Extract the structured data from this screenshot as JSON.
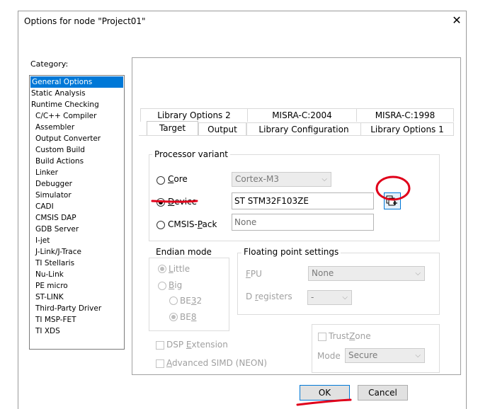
{
  "window": {
    "title": "Options for node \"Project01\""
  },
  "category": {
    "label": "Category:",
    "items": [
      {
        "label": "General Options",
        "indent": false,
        "selected": true
      },
      {
        "label": "Static Analysis",
        "indent": false
      },
      {
        "label": "Runtime Checking",
        "indent": false
      },
      {
        "label": "C/C++ Compiler",
        "indent": true
      },
      {
        "label": "Assembler",
        "indent": true
      },
      {
        "label": "Output Converter",
        "indent": true
      },
      {
        "label": "Custom Build",
        "indent": true
      },
      {
        "label": "Build Actions",
        "indent": true
      },
      {
        "label": "Linker",
        "indent": true
      },
      {
        "label": "Debugger",
        "indent": true
      },
      {
        "label": "Simulator",
        "indent": true
      },
      {
        "label": "CADI",
        "indent": true
      },
      {
        "label": "CMSIS DAP",
        "indent": true
      },
      {
        "label": "GDB Server",
        "indent": true
      },
      {
        "label": "I-jet",
        "indent": true
      },
      {
        "label": "J-Link/J-Trace",
        "indent": true
      },
      {
        "label": "TI Stellaris",
        "indent": true
      },
      {
        "label": "Nu-Link",
        "indent": true
      },
      {
        "label": "PE micro",
        "indent": true
      },
      {
        "label": "ST-LINK",
        "indent": true
      },
      {
        "label": "Third-Party Driver",
        "indent": true
      },
      {
        "label": "TI MSP-FET",
        "indent": true
      },
      {
        "label": "TI XDS",
        "indent": true
      }
    ]
  },
  "tabs_top": [
    "Library Options 2",
    "MISRA-C:2004",
    "MISRA-C:1998"
  ],
  "tabs_bottom": [
    "Target",
    "Output",
    "Library Configuration",
    "Library Options 1"
  ],
  "processor": {
    "title": "Processor variant",
    "core_label": "Core",
    "core_value": "Cortex-M3",
    "device_label": "Device",
    "device_value": "ST STM32F103ZE",
    "cmsis_label": "CMSIS-Pack",
    "cmsis_value": "None"
  },
  "endian": {
    "title": "Endian mode",
    "little": "Little",
    "big": "Big",
    "be32": "BE32",
    "be8": "BE8"
  },
  "fpu": {
    "title": "Floating point settings",
    "fpu_label": "FPU",
    "fpu_value": "None",
    "dreg_label": "D registers",
    "dreg_value": "-"
  },
  "trustzone": {
    "label": "TrustZone",
    "mode_label": "Mode",
    "mode_value": "Secure"
  },
  "dsp_label": "DSP Extension",
  "simd_label": "Advanced SIMD (NEON)",
  "buttons": {
    "ok": "OK",
    "cancel": "Cancel"
  },
  "annotation_color": "#e0001a"
}
